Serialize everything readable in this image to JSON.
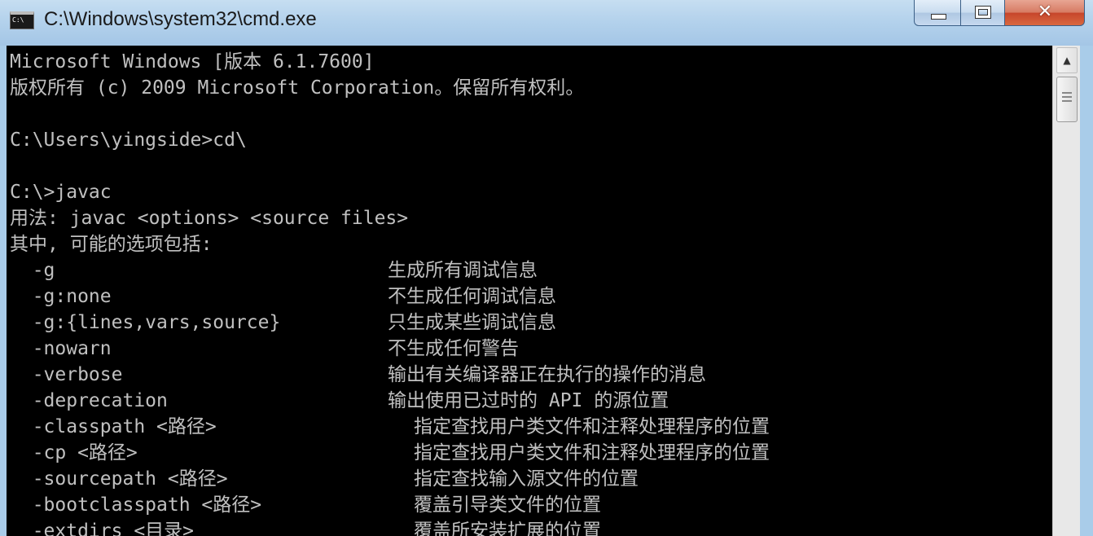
{
  "window": {
    "title": "C:\\Windows\\system32\\cmd.exe",
    "icon_label": "C:\\",
    "minimize_glyph": "",
    "close_glyph": "✕"
  },
  "console": {
    "header_lines": [
      "Microsoft Windows [版本 6.1.7600]",
      "版权所有 (c) 2009 Microsoft Corporation。保留所有权利。",
      "",
      "C:\\Users\\yingside>cd\\",
      "",
      "C:\\>javac",
      "用法: javac <options> <source files>",
      "其中, 可能的选项包括:"
    ],
    "options": [
      {
        "flag": "  -g",
        "desc": "生成所有调试信息"
      },
      {
        "flag": "  -g:none",
        "desc": "不生成任何调试信息"
      },
      {
        "flag": "  -g:{lines,vars,source}",
        "desc": "只生成某些调试信息"
      },
      {
        "flag": "  -nowarn",
        "desc": "不生成任何警告"
      },
      {
        "flag": "  -verbose",
        "desc": "输出有关编译器正在执行的操作的消息"
      },
      {
        "flag": "  -deprecation",
        "desc": "输出使用已过时的 API 的源位置"
      },
      {
        "flag": "  -classpath <路径>",
        "desc": "指定查找用户类文件和注释处理程序的位置"
      },
      {
        "flag": "  -cp <路径>",
        "desc": "指定查找用户类文件和注释处理程序的位置"
      },
      {
        "flag": "  -sourcepath <路径>",
        "desc": "指定查找输入源文件的位置"
      },
      {
        "flag": "  -bootclasspath <路径>",
        "desc": "覆盖引导类文件的位置"
      },
      {
        "flag": "  -extdirs <目录>",
        "desc": "覆盖所安装扩展的位置"
      }
    ]
  },
  "scrollbar": {
    "up_glyph": "▲"
  },
  "colors": {
    "console_bg": "#000000",
    "console_fg": "#c0c0c0",
    "titlebar": "#b4d2ec",
    "close_button": "#c6452b"
  }
}
